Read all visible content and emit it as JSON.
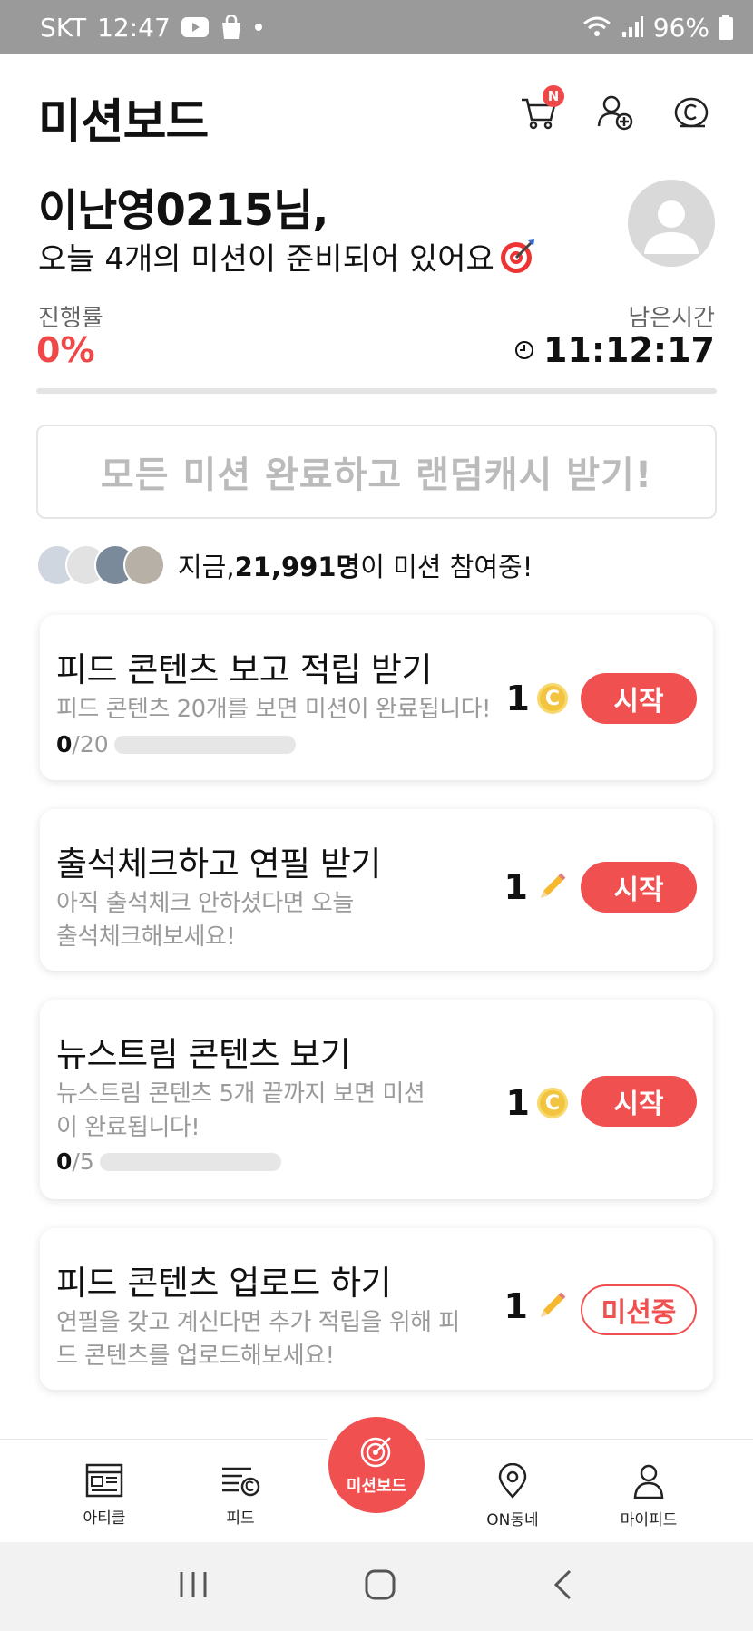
{
  "status_bar": {
    "carrier": "SKT",
    "time": "12:47",
    "battery": "96%"
  },
  "header": {
    "title": "미션보드",
    "cart_badge": "N"
  },
  "greeting": {
    "name": "이난영0215님,",
    "subtitle": "오늘 4개의 미션이 준비되어 있어요"
  },
  "progress": {
    "label": "진행률",
    "value": "0%"
  },
  "remaining": {
    "label": "남은시간",
    "value": "11:12:17"
  },
  "reward_banner": {
    "text": "모든 미션 완료하고 랜덤캐시 받기!"
  },
  "participants": {
    "prefix": "지금, ",
    "count": "21,991명",
    "suffix": "이 미션 참여중!"
  },
  "missions": [
    {
      "title": "피드 콘텐츠 보고 적립 받기",
      "desc": "피드 콘텐츠 20개를 보면 미션이 완료됩니다!",
      "progress_done": "0",
      "progress_total": "/20",
      "reward_amount": "1",
      "reward_icon": "coin-icon",
      "button": "시작"
    },
    {
      "title": "출석체크하고 연필 받기",
      "desc": "아직 출석체크 안하셨다면 오늘 출석체크해보세요!",
      "reward_amount": "1",
      "reward_icon": "pencil-icon",
      "button": "시작"
    },
    {
      "title": "뉴스트림 콘텐츠 보기",
      "desc": "뉴스트림 콘텐츠 5개 끝까지 보면 미션이 완료됩니다!",
      "progress_done": "0",
      "progress_total": "/5",
      "reward_amount": "1",
      "reward_icon": "coin-icon",
      "button": "시작"
    },
    {
      "title": "피드 콘텐츠 업로드 하기",
      "desc": "연필을 갖고 계신다면 추가 적립을 위해 피드 콘텐츠를 업로드해보세요!",
      "reward_amount": "1",
      "reward_icon": "pencil-icon",
      "button": "미션중"
    }
  ],
  "bottom_nav": {
    "article": "아티클",
    "feed": "피드",
    "mission": "미션보드",
    "neighborhood": "ON동네",
    "my": "마이피드"
  },
  "colors": {
    "accent": "#f05050",
    "coin": "#f3c53f",
    "statusbar": "#9a9a9a"
  }
}
